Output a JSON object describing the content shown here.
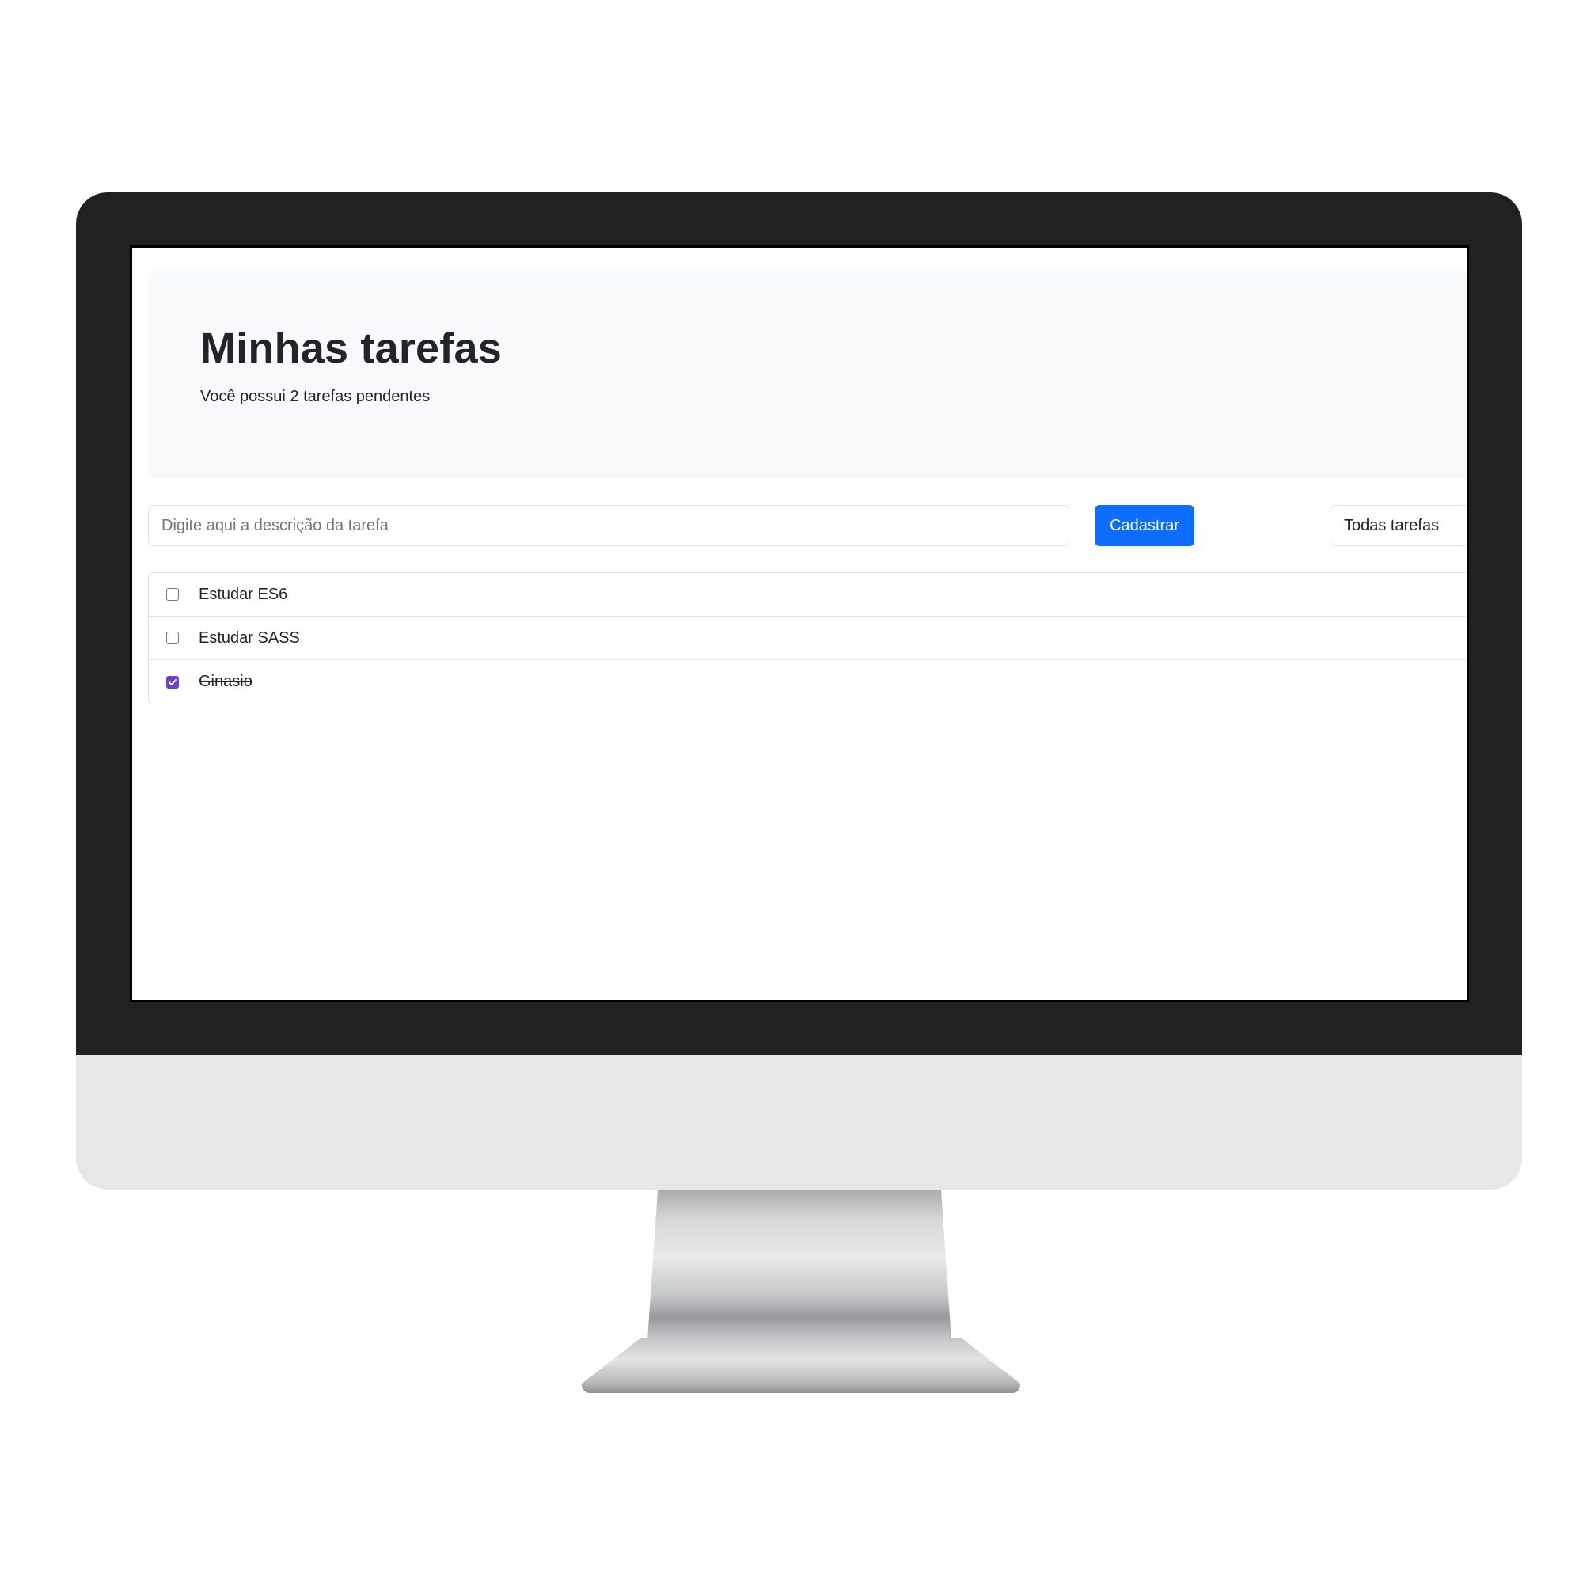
{
  "header": {
    "title": "Minhas tarefas",
    "subtitle": "Você possui 2 tarefas pendentes"
  },
  "form": {
    "input_placeholder": "Digite aqui a descrição da tarefa",
    "submit_label": "Cadastrar",
    "filter_selected": "Todas tarefas"
  },
  "tasks": [
    {
      "label": "Estudar ES6",
      "done": false
    },
    {
      "label": "Estudar SASS",
      "done": false
    },
    {
      "label": "Ginasio",
      "done": true
    }
  ],
  "colors": {
    "primary": "#0d6efd",
    "checked": "#6f42c1",
    "text": "#212529",
    "jumbotron_bg": "#f8f9fa"
  },
  "icons": {
    "checkbox_checked": "check-icon"
  }
}
